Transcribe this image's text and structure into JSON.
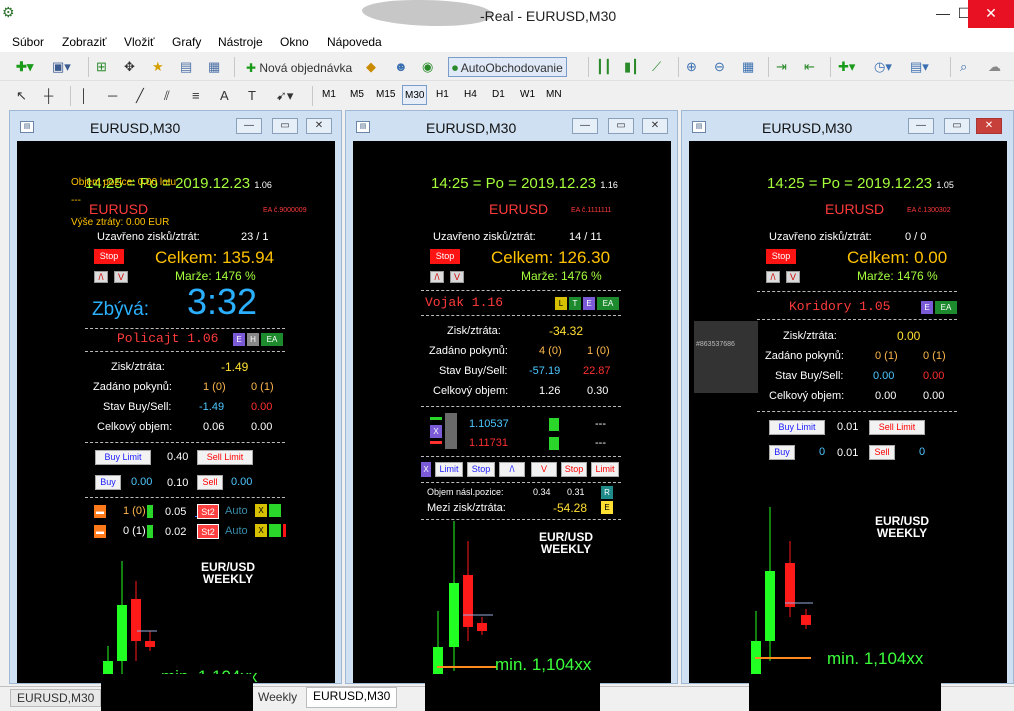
{
  "window": {
    "title": "-Real - EURUSD,M30",
    "minimize": "—",
    "maximize": "☐",
    "close": "✕"
  },
  "menu": [
    "Súbor",
    "Zobraziť",
    "Vložiť",
    "Grafy",
    "Nástroje",
    "Okno",
    "Nápoveda"
  ],
  "toolbar": {
    "new_order": "Nová objednávka",
    "autotrading": "AutoObchodovanie",
    "timeframes": [
      "M1",
      "M5",
      "M15",
      "M30",
      "H1",
      "H4",
      "D1",
      "W1",
      "MN"
    ],
    "active_timeframe": "M30"
  },
  "charts": [
    {
      "name": "EURUSD,M30",
      "clock": "14:25 = Po = 2019.12.23",
      "clock_ver": "1.06",
      "overlay_line1": "Objem pozice: 0.00 lotu",
      "overlay_line2": "---",
      "overlay_line3": "Výše ztráty: 0.00 EUR",
      "symbol": "EURUSD",
      "ea_id": "EA č.9000009",
      "closed_label": "Uzavřeno zisků/ztrát:",
      "closed_value": "23 / 1",
      "stop_label": "Stop",
      "total": "Celkem: 135.94",
      "marze": "Marže:  1476 %",
      "zbyva_label": "Zbývá:",
      "zbyva_value": "3:32",
      "strategy": "Policajt 1.06",
      "strategy_tags": [
        "E",
        "H",
        "EA"
      ],
      "pl_label": "Zisk/ztráta:",
      "pl_value": "-1.49",
      "orders_label": "Zadáno pokynů:",
      "orders_buy": "1 (0)",
      "orders_sell": "0 (1)",
      "state_label": "Stav Buy/Sell:",
      "state_buy": "-1.49",
      "state_sell": "0.00",
      "volume_label": "Celkový objem:",
      "volume_buy": "0.06",
      "volume_sell": "0.00",
      "buy_limit_btn": "Buy Limit",
      "buy_limit_val": "0.40",
      "sell_limit_btn": "Sell Limit",
      "buy_btn": "Buy",
      "buy_val": "0.00",
      "buy_lot": "0.10",
      "sell_btn": "Sell",
      "sell_val": "0.00",
      "row1_count": "1 (0)",
      "row1_lot": "0.05",
      "row2_count": "0 (1)",
      "row2_lot": "0.02",
      "st2_label": "St2",
      "auto_label": "Auto",
      "weekly_line1": "EUR/USD",
      "weekly_line2": "WEEKLY",
      "min_label": "min. 1,104xx"
    },
    {
      "name": "EURUSD,M30",
      "clock": "14:25 = Po = 2019.12.23",
      "clock_ver": "1.16",
      "symbol": "EURUSD",
      "ea_id": "EA č.1111111",
      "closed_label": "Uzavřeno zisků/ztrát:",
      "closed_value": "14 / 11",
      "stop_label": "Stop",
      "total": "Celkem: 126.30",
      "marze": "Marže:  1476 %",
      "strategy": "Vojak 1.16",
      "strategy_tags": [
        "L",
        "T",
        "E",
        "EA"
      ],
      "pl_label": "Zisk/ztráta:",
      "pl_value": "-34.32",
      "orders_label": "Zadáno pokynů:",
      "orders_buy": "4 (0)",
      "orders_sell": "1 (0)",
      "state_label": "Stav Buy/Sell:",
      "state_buy": "-57.19",
      "state_sell": "22.87",
      "volume_label": "Celkový objem:",
      "volume_buy": "1.26",
      "volume_sell": "0.30",
      "price_buy": "1.10537",
      "price_sell": "1.11731",
      "dash": "---",
      "btns": [
        "X",
        "Limit",
        "Stop",
        "/\\",
        "V",
        "Stop",
        "Limit"
      ],
      "nasl_label": "Objem násl.pozice:",
      "nasl_buy": "0.34",
      "nasl_sell": "0.31",
      "mezi_label": "Mezi zisk/ztráta:",
      "mezi_value": "-54.28",
      "weekly_line1": "EUR/USD",
      "weekly_line2": "WEEKLY",
      "min_label": "min. 1,104xx"
    },
    {
      "name": "EURUSD,M30",
      "clock": "14:25 = Po = 2019.12.23",
      "clock_ver": "1.05",
      "symbol": "EURUSD",
      "ea_id": "EA č.1300302",
      "closed_label": "Uzavřeno zisků/ztrát:",
      "closed_value": "0 / 0",
      "stop_label": "Stop",
      "total": "Celkem: 0.00",
      "marze": "Marže:  1476 %",
      "strategy": "Koridory 1.05",
      "strategy_tags": [
        "E",
        "EA"
      ],
      "grey_tag": "#863537686",
      "pl_label": "Zisk/ztráta:",
      "pl_value": "0.00",
      "orders_label": "Zadáno pokynů:",
      "orders_buy": "0 (1)",
      "orders_sell": "0 (1)",
      "state_label": "Stav Buy/Sell:",
      "state_buy": "0.00",
      "state_sell": "0.00",
      "volume_label": "Celkový objem:",
      "volume_buy": "0.00",
      "volume_sell": "0.00",
      "buy_limit_btn": "Buy Limit",
      "buy_limit_val": "0.01",
      "sell_limit_btn": "Sell Limit",
      "buy_btn": "Buy",
      "buy_val": "0",
      "buy_lot": "0.01",
      "sell_btn": "Sell",
      "sell_val": "0",
      "weekly_line1": "EUR/USD",
      "weekly_line2": "WEEKLY",
      "min_label": "min. 1,104xx"
    }
  ],
  "tabs": [
    "EURUSD,M30",
    "Weekly",
    "EURUSD,M30"
  ],
  "colors": {
    "accent_green": "#a6ff3c",
    "accent_red": "#ff3b3b",
    "accent_gold": "#ffc200"
  }
}
